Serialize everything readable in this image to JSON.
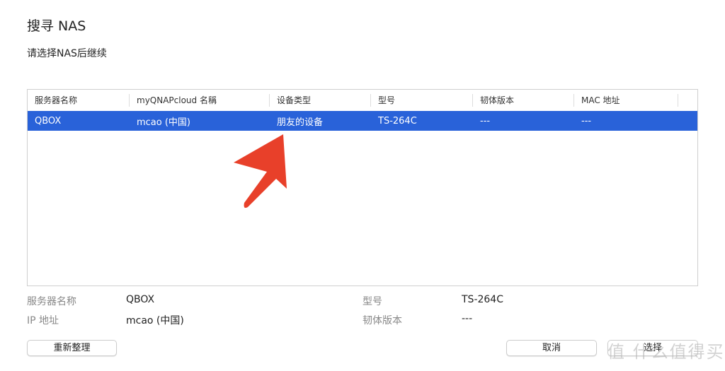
{
  "title": "搜寻 NAS",
  "subtitle": "请选择NAS后继续",
  "table": {
    "headers": [
      "服务器名称",
      "myQNAPcloud 名稱",
      "设备类型",
      "型号",
      "韧体版本",
      "MAC 地址"
    ],
    "rows": [
      [
        "QBOX",
        "mcao (中国)",
        "朋友的设备",
        "TS-264C",
        "---",
        "---"
      ]
    ]
  },
  "details": {
    "server_name_label": "服务器名称",
    "server_name": "QBOX",
    "ip_label": "IP 地址",
    "ip": "mcao (中国)",
    "model_label": "型号",
    "model": "TS-264C",
    "firmware_label": "韧体版本",
    "firmware": "---"
  },
  "buttons": {
    "refresh": "重新整理",
    "cancel": "取消",
    "select": "选择"
  },
  "watermark": "值 什么值得买",
  "colors": {
    "selection": "#2962d9",
    "arrow": "#e8402a"
  }
}
